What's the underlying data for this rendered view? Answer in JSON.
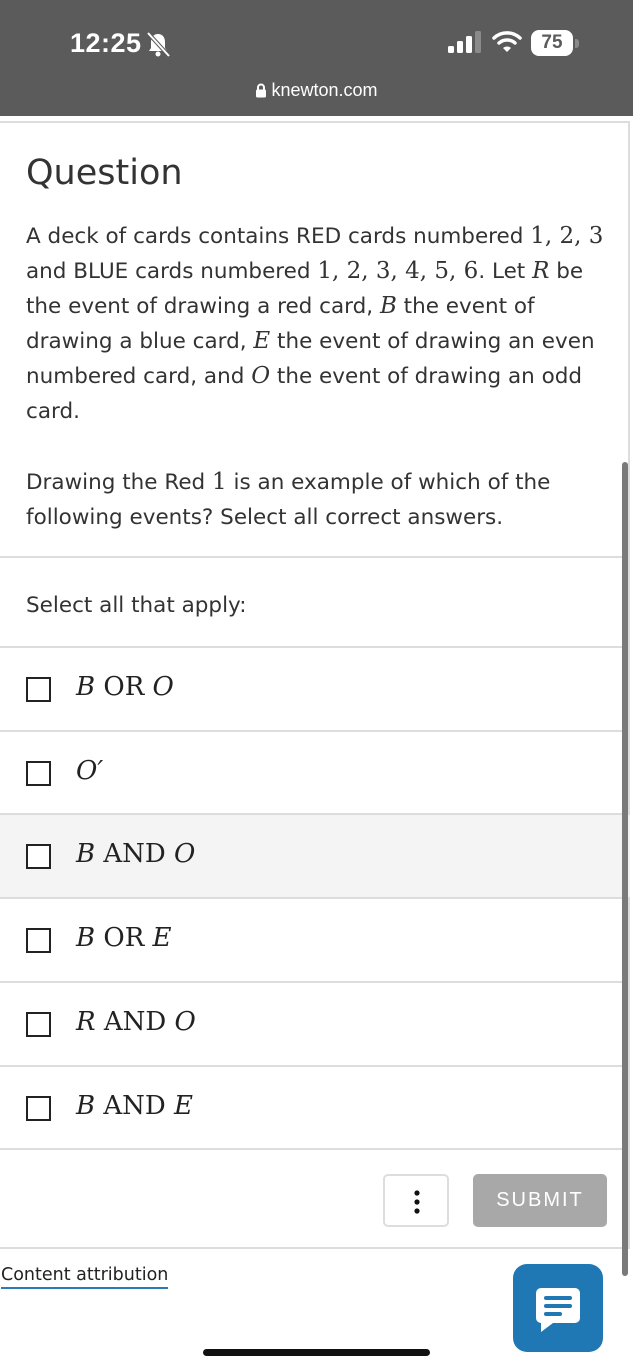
{
  "status_bar": {
    "time": "12:25",
    "battery_level": "75",
    "url": "knewton.com",
    "icons": [
      "bell-slash-icon",
      "signal-icon",
      "wifi-icon",
      "battery-icon",
      "lock-icon"
    ]
  },
  "question": {
    "heading": "Question",
    "paragraph1": {
      "t1": "A deck of cards contains RED cards numbered ",
      "m1": "1, 2, 3",
      "t2": " and BLUE cards numbered ",
      "m2": "1, 2, 3, 4, 5, 6",
      "t3": ". Let ",
      "m3": "R",
      "t4": " be the event of drawing a red card, ",
      "m4": "B",
      "t5": " the event of drawing a blue card, ",
      "m5": "E",
      "t6": " the event of drawing an even numbered card, and ",
      "m6": "O",
      "t7": " the event of drawing an odd card."
    },
    "paragraph2": {
      "t1": "Drawing the Red ",
      "m1": "1",
      "t2": " is an example of which of the following events? Select all correct answers."
    }
  },
  "select_label": "Select all that apply:",
  "options": [
    {
      "a": "B",
      "op": " OR ",
      "b": "O",
      "checked": false
    },
    {
      "a": "O′",
      "op": "",
      "b": "",
      "checked": false
    },
    {
      "a": "B",
      "op": " AND ",
      "b": "O",
      "checked": false
    },
    {
      "a": "B",
      "op": " OR ",
      "b": "E",
      "checked": false
    },
    {
      "a": "R",
      "op": " AND ",
      "b": "O",
      "checked": false
    },
    {
      "a": "B",
      "op": " AND ",
      "b": "E",
      "checked": false
    }
  ],
  "buttons": {
    "more_icon": "more-vertical-icon",
    "submit": "SUBMIT"
  },
  "footer": {
    "attribution": "Content attribution",
    "chat_icon": "chat-icon"
  },
  "colors": {
    "status_bar_bg": "#5b5b5b",
    "submit_disabled": "#a8a8a8",
    "chat_button": "#1f78b4",
    "attribution_underline": "#2b7bb9"
  }
}
